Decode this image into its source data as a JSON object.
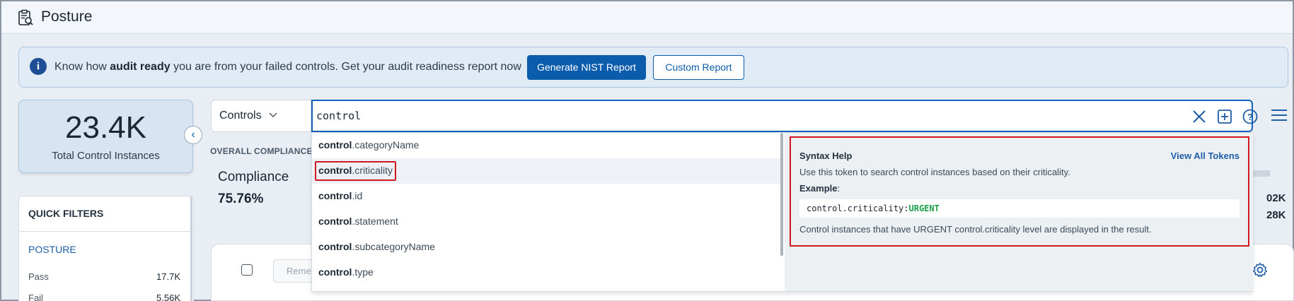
{
  "header": {
    "title": "Posture",
    "logo_icon": "clipboard-search-icon"
  },
  "banner": {
    "msg_before": "Know how ",
    "msg_bold": "audit ready",
    "msg_after": " you are from your failed controls. Get your audit readiness report now",
    "primary_button": "Generate NIST Report",
    "secondary_button": "Custom Report"
  },
  "stat": {
    "value": "23.4K",
    "label": "Total Control Instances"
  },
  "quick_filters": {
    "title": "QUICK FILTERS",
    "section": "POSTURE",
    "rows": [
      {
        "label": "Pass",
        "value": "17.7K"
      },
      {
        "label": "Fail",
        "value": "5.56K"
      }
    ]
  },
  "overall": {
    "label": "OVERALL COMPLIANCE",
    "compliance_label": "Compliance",
    "compliance_value": "75.76%"
  },
  "right_values": [
    "02K",
    "28K"
  ],
  "lower": {
    "remediate_label": "Remed"
  },
  "search": {
    "filter_label": "Controls",
    "query": "control",
    "suggestions": [
      {
        "bold": "control",
        "rest": ".categoryName"
      },
      {
        "bold": "control",
        "rest": ".criticality"
      },
      {
        "bold": "control",
        "rest": ".id"
      },
      {
        "bold": "control",
        "rest": ".statement"
      },
      {
        "bold": "control",
        "rest": ".subcategoryName"
      },
      {
        "bold": "control",
        "rest": ".type"
      }
    ],
    "active_index": 1
  },
  "syntax_help": {
    "title": "Syntax Help",
    "link": "View All Tokens",
    "description": "Use this token to search control instances based on their criticality.",
    "example_label": "Example",
    "example_colon": ":",
    "code_token": "control.criticality:",
    "code_value": "URGENT",
    "result": "Control instances that have URGENT control.criticality level are displayed in the result."
  },
  "colors": {
    "brand": "#0b5cad",
    "highlight": "#d0181f",
    "code_value": "#1c9d4a"
  }
}
